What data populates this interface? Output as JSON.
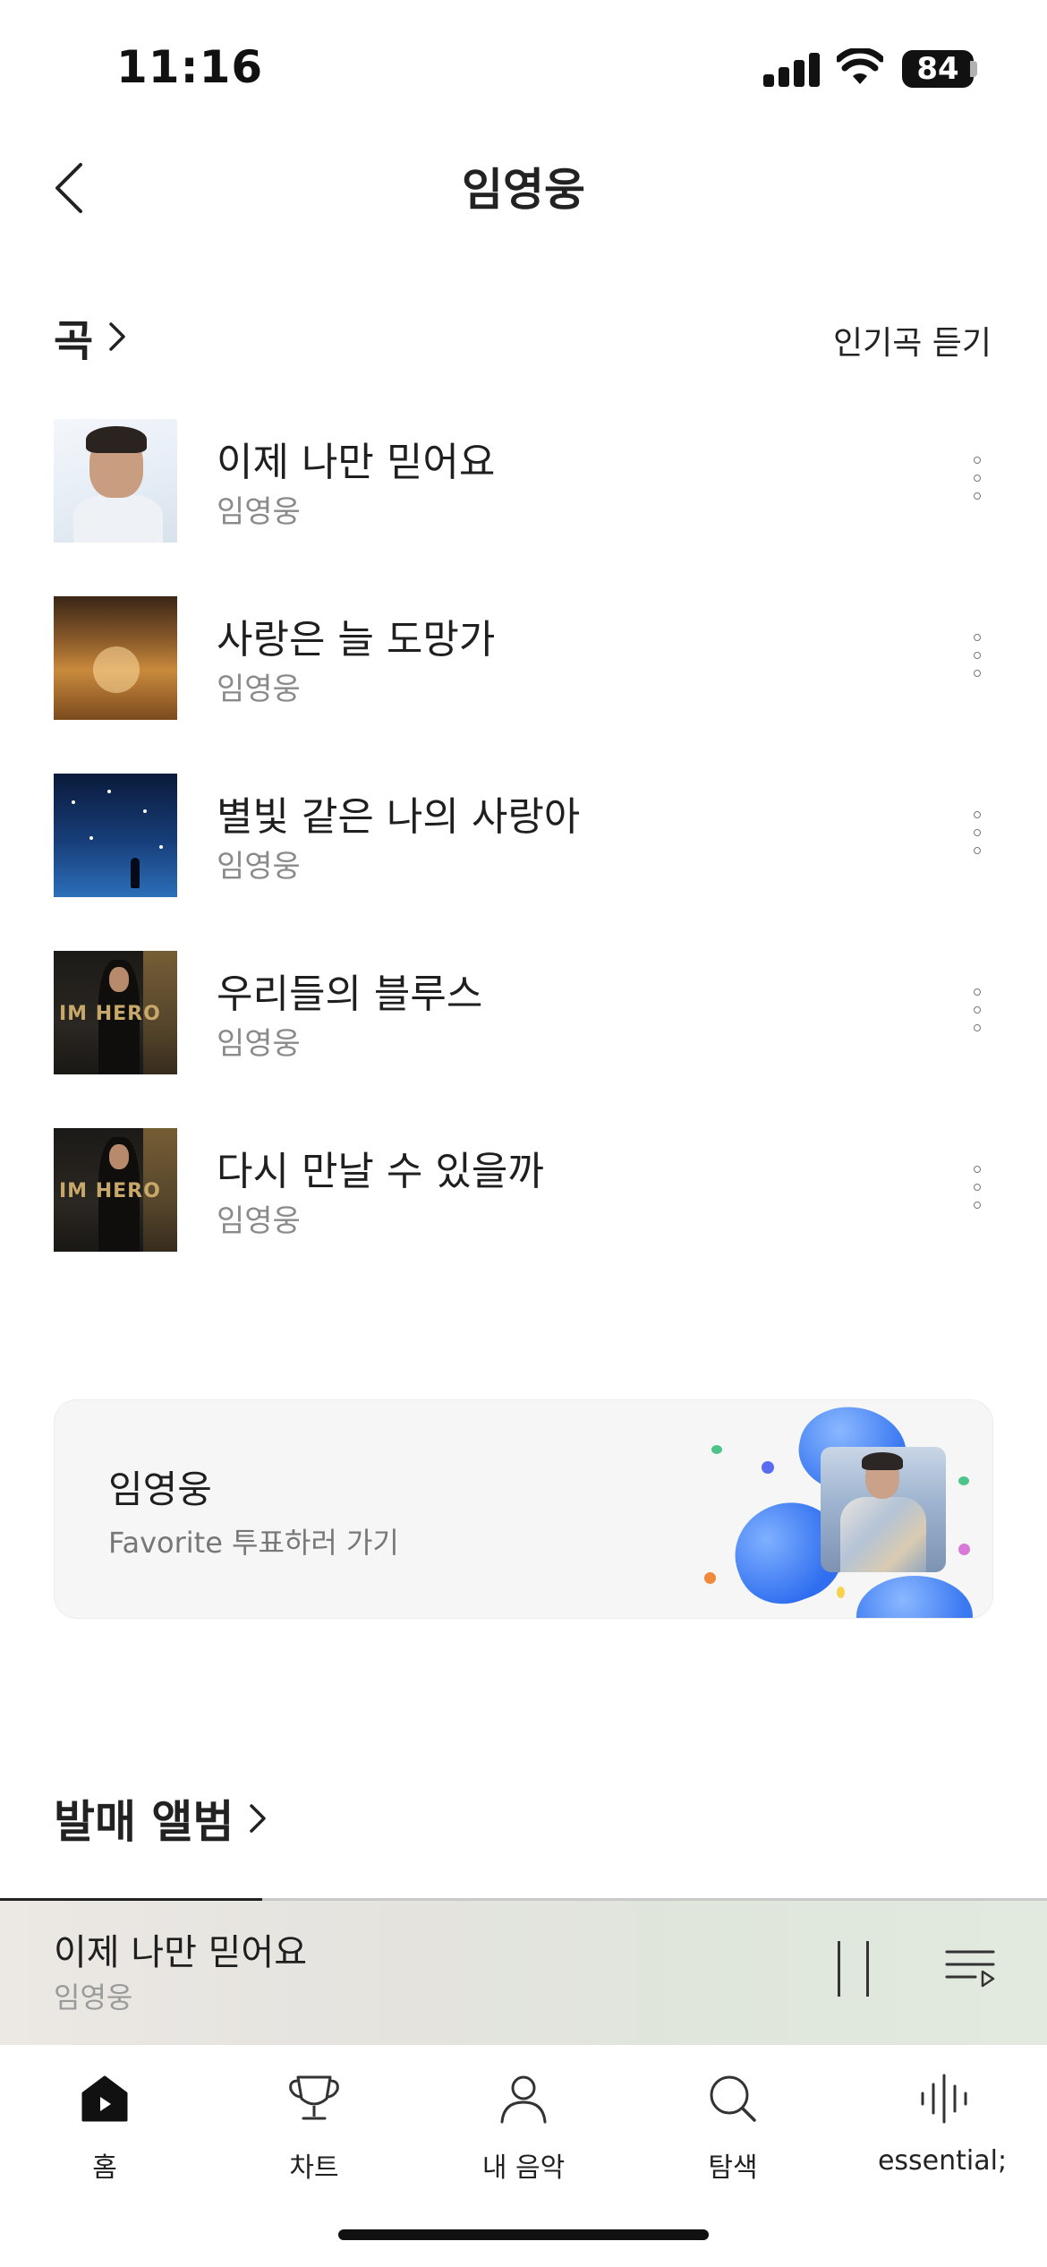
{
  "status_bar": {
    "time": "11:16",
    "battery": "84"
  },
  "header": {
    "title": "임영웅"
  },
  "songs_section": {
    "title": "곡",
    "popular_link": "인기곡 듣기"
  },
  "songs": [
    {
      "title": "이제 나만 믿어요",
      "artist": "임영웅"
    },
    {
      "title": "사랑은 늘 도망가",
      "artist": "임영웅"
    },
    {
      "title": "별빛 같은 나의 사랑아",
      "artist": "임영웅"
    },
    {
      "title": "우리들의 블루스",
      "artist": "임영웅"
    },
    {
      "title": "다시 만날 수 있을까",
      "artist": "임영웅"
    }
  ],
  "favorite_card": {
    "name": "임영웅",
    "subtitle": "Favorite 투표하러 가기"
  },
  "albums_section": {
    "title": "발매 앨범"
  },
  "mini_player": {
    "title": "이제 나만 믿어요",
    "artist": "임영웅",
    "progress": 0.25
  },
  "tab_bar": {
    "items": [
      {
        "label": "홈",
        "icon": "home-play-icon",
        "active": true
      },
      {
        "label": "차트",
        "icon": "trophy-icon",
        "active": false
      },
      {
        "label": "내 음악",
        "icon": "person-icon",
        "active": false
      },
      {
        "label": "탐색",
        "icon": "search-icon",
        "active": false
      },
      {
        "label": "essential;",
        "icon": "waveform-icon",
        "active": false
      }
    ]
  },
  "colors": {
    "accent_heart": "#3d7bf2",
    "text_primary": "#1f1f1f",
    "text_secondary": "#8a8a8a"
  }
}
